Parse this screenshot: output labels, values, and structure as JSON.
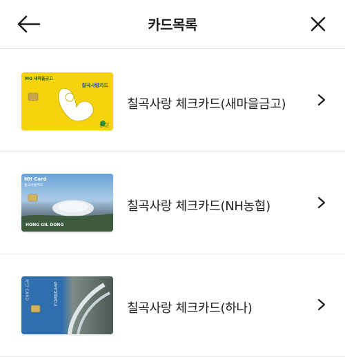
{
  "header": {
    "title": "카드목록"
  },
  "cards": [
    {
      "name": "칠곡사랑 체크카드(새마을금고)",
      "brand_text": "MG 새마을금고",
      "card_label": "칠곡사랑카드",
      "issuer_small": "칠곡군",
      "color": "#f5d30f"
    },
    {
      "name": "칠곡사랑 체크카드(NH농협)",
      "brand_text": "NH Card",
      "card_label": "칠곡사랑카드",
      "holder": "HONG GIL DONG",
      "color": "#3a78b8"
    },
    {
      "name": "칠곡사랑 체크카드(하나)",
      "brand_text": "하나 CARD",
      "card_label": "칠곡사랑카드",
      "color": "#2f6fb0"
    }
  ],
  "icons": {
    "back": "arrow-left-icon",
    "close": "close-icon",
    "chevron": "chevron-right-icon"
  }
}
